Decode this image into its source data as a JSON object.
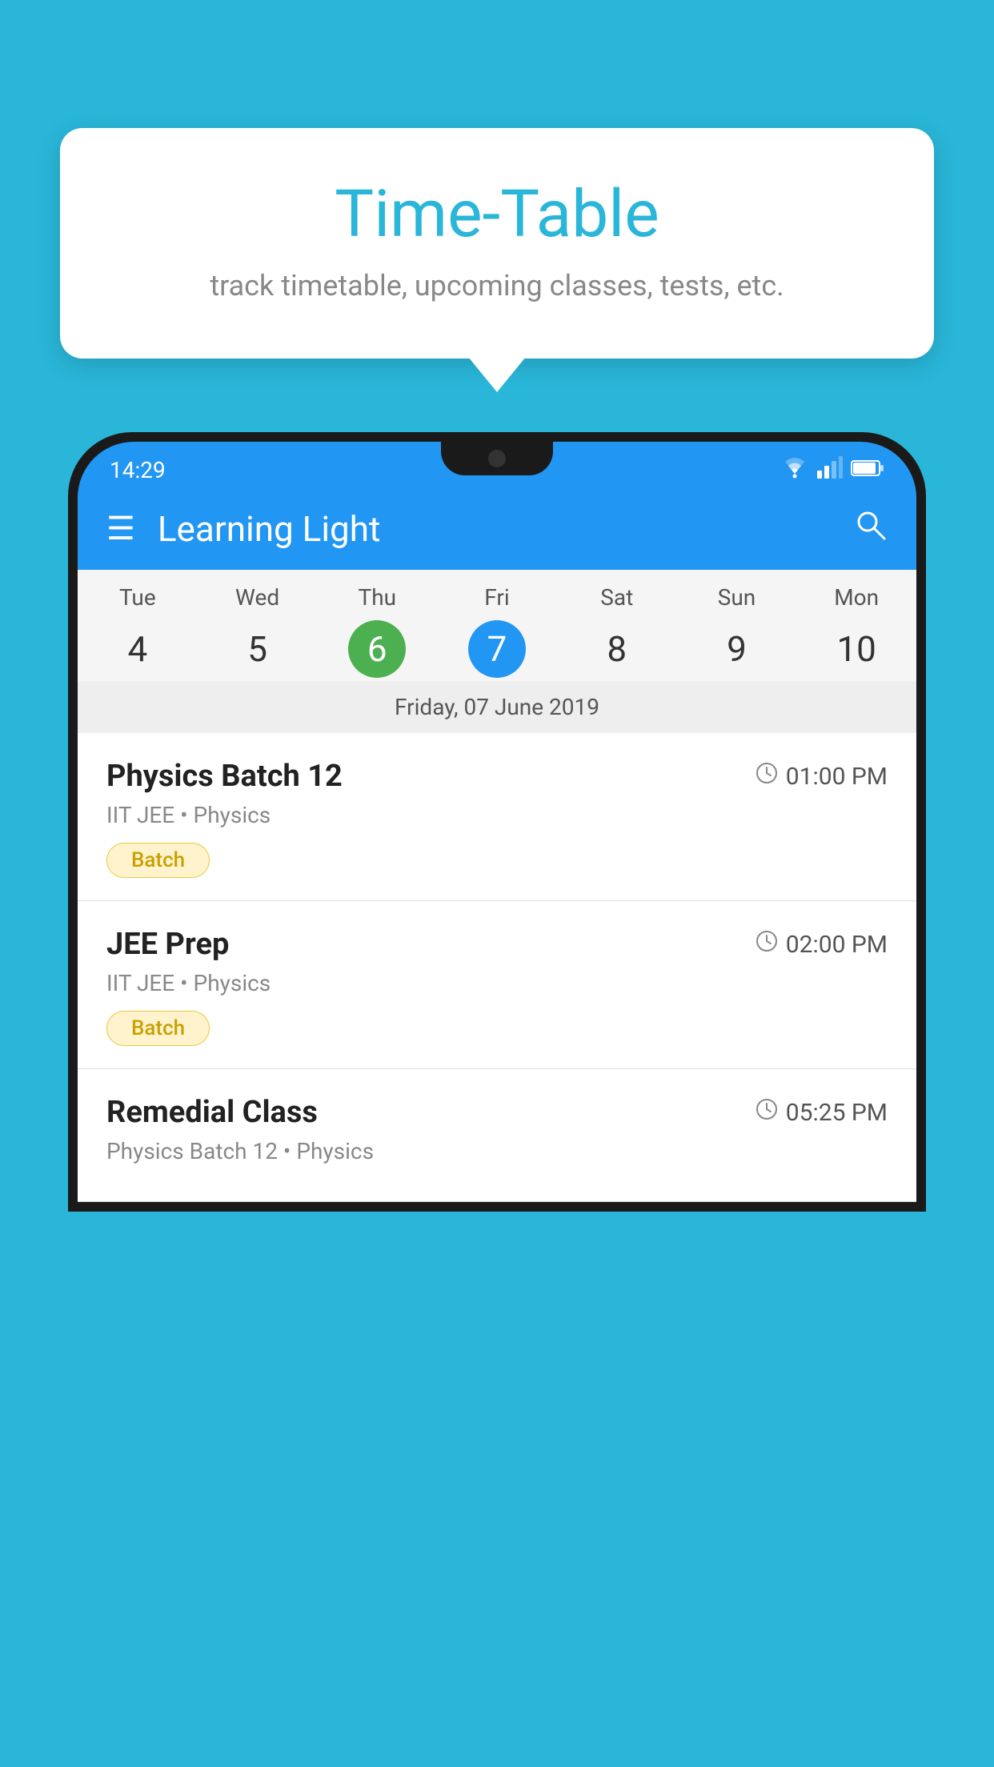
{
  "background_color": "#29b6d8",
  "tooltip": {
    "title": "Time-Table",
    "subtitle": "track timetable, upcoming classes, tests, etc."
  },
  "phone": {
    "status_bar": {
      "time": "14:29"
    },
    "app_bar": {
      "title": "Learning Light"
    },
    "calendar": {
      "days": [
        {
          "name": "Tue",
          "num": "4",
          "state": "normal"
        },
        {
          "name": "Wed",
          "num": "5",
          "state": "normal"
        },
        {
          "name": "Thu",
          "num": "6",
          "state": "today"
        },
        {
          "name": "Fri",
          "num": "7",
          "state": "selected"
        },
        {
          "name": "Sat",
          "num": "8",
          "state": "normal"
        },
        {
          "name": "Sun",
          "num": "9",
          "state": "normal"
        },
        {
          "name": "Mon",
          "num": "10",
          "state": "normal"
        }
      ],
      "selected_date_label": "Friday, 07 June 2019"
    },
    "schedule": [
      {
        "title": "Physics Batch 12",
        "time": "01:00 PM",
        "subtitle": "IIT JEE • Physics",
        "tag": "Batch"
      },
      {
        "title": "JEE Prep",
        "time": "02:00 PM",
        "subtitle": "IIT JEE • Physics",
        "tag": "Batch"
      },
      {
        "title": "Remedial Class",
        "time": "05:25 PM",
        "subtitle": "Physics Batch 12 • Physics",
        "tag": null
      }
    ]
  }
}
